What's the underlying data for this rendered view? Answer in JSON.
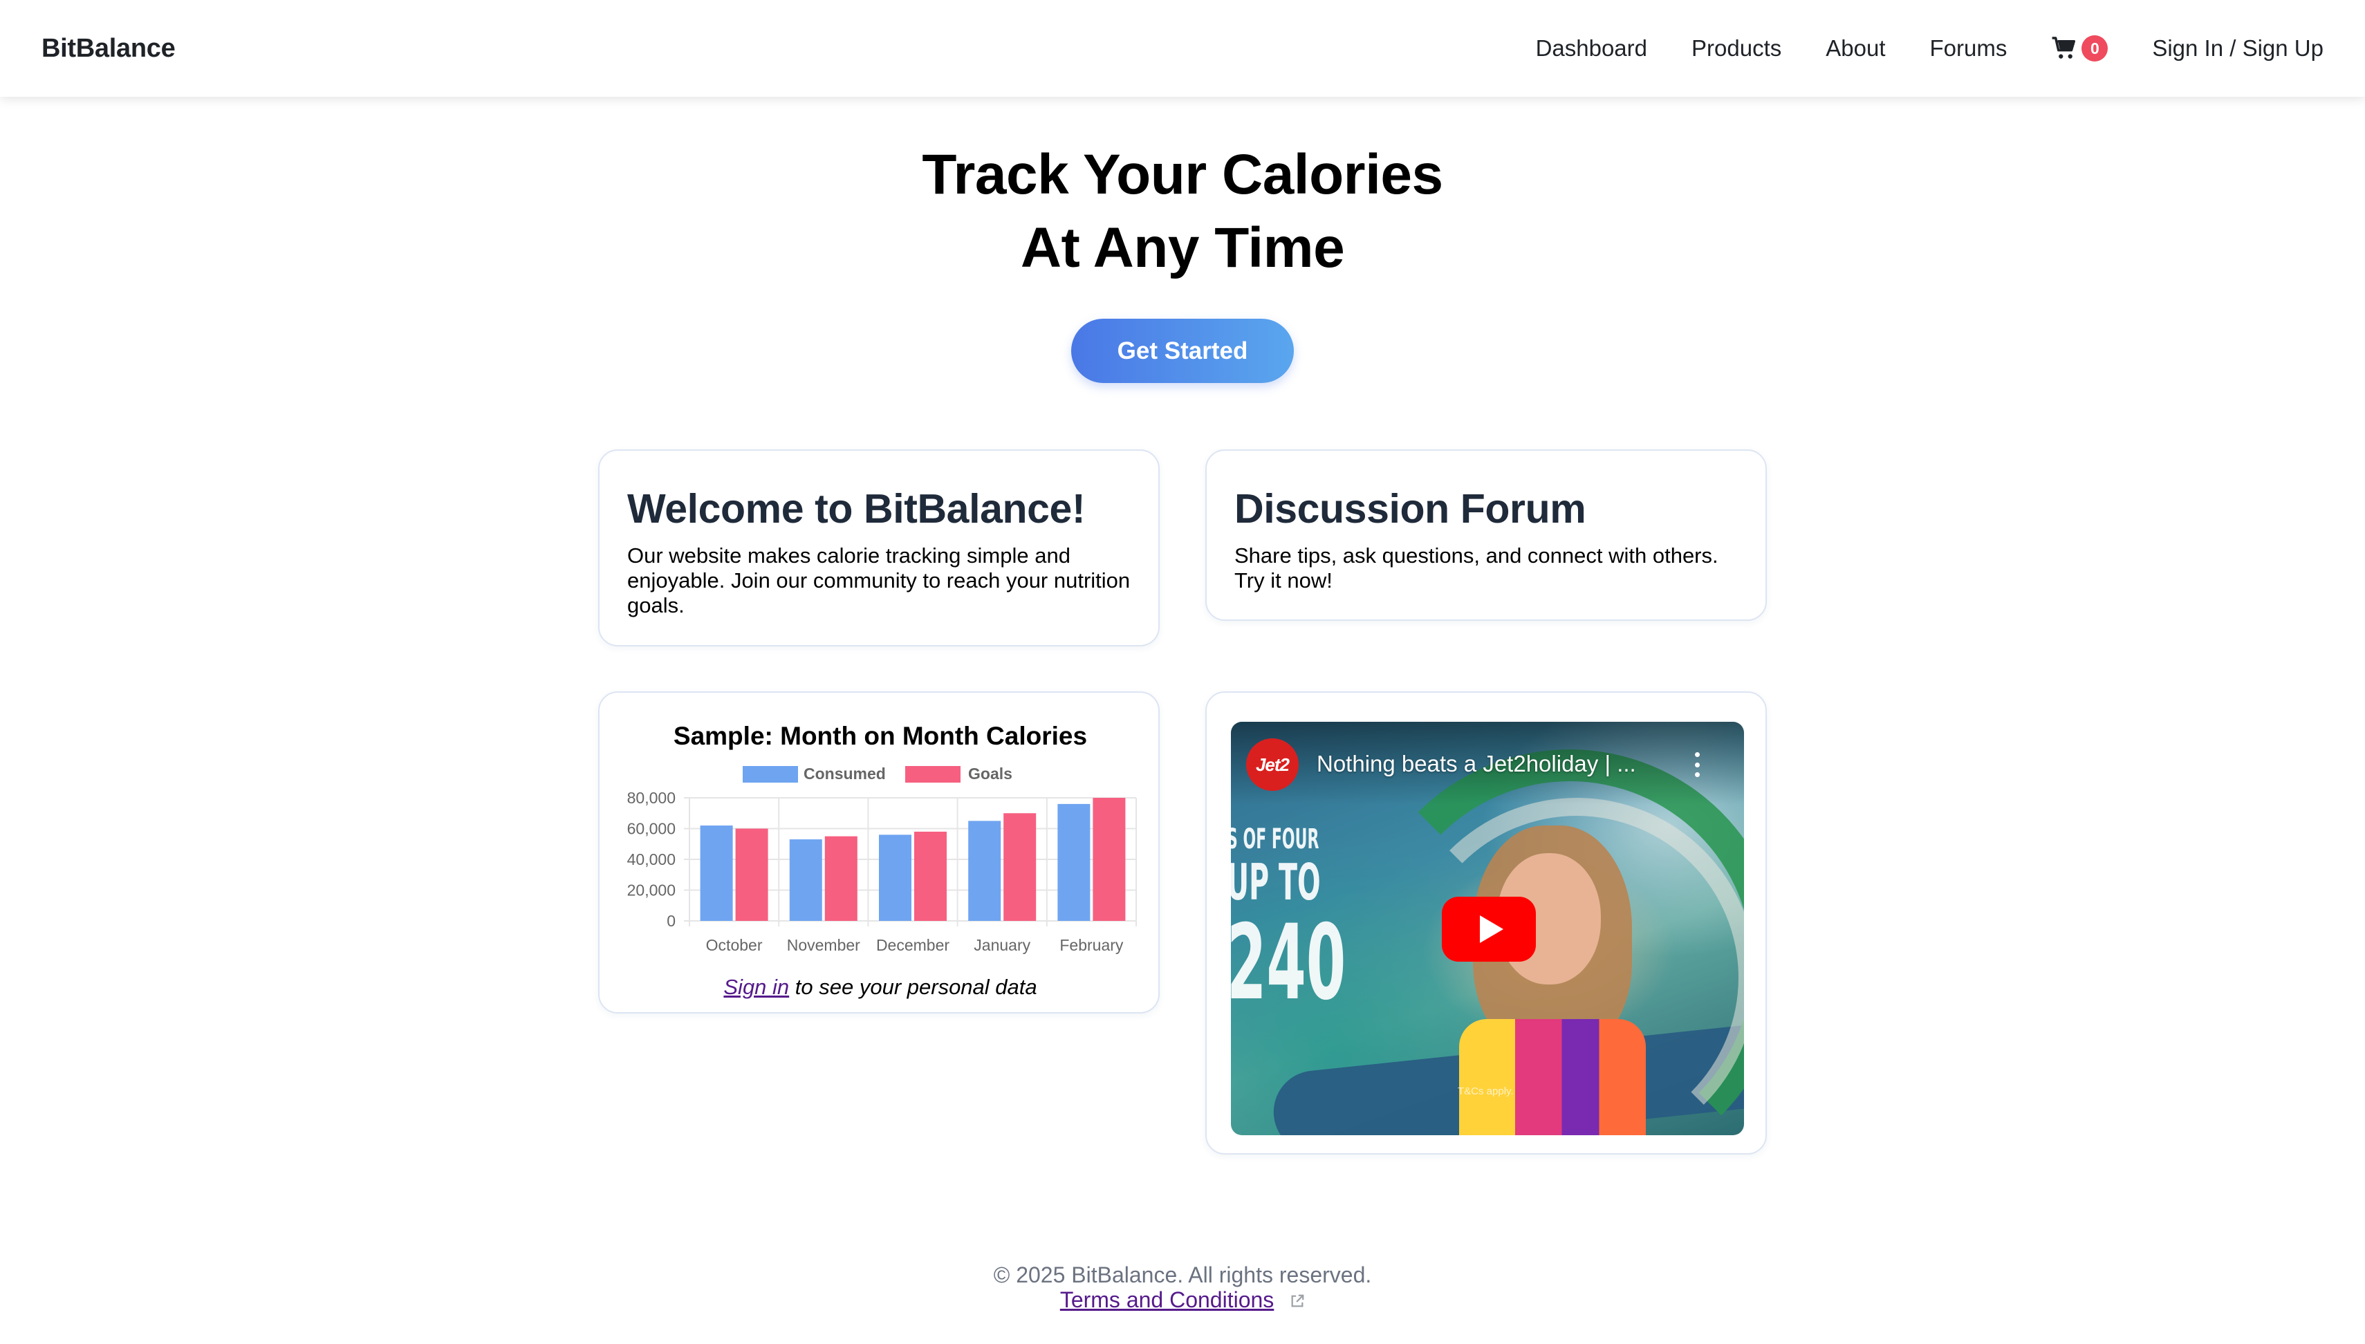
{
  "navbar": {
    "brand": "BitBalance",
    "links": [
      "Dashboard",
      "Products",
      "About",
      "Forums"
    ],
    "cart_count": "0",
    "signin_label": "Sign In / Sign Up"
  },
  "hero": {
    "title_line1": "Track Your Calories",
    "title_line2": "At Any Time",
    "cta_label": "Get Started"
  },
  "welcome_card": {
    "title": "Welcome to BitBalance!",
    "body": "Our website makes calorie tracking simple and enjoyable. Join our community to reach your nutrition goals."
  },
  "forum_card": {
    "title": "Discussion Forum",
    "body": "Share tips, ask questions, and connect with others. Try it now!"
  },
  "chart_card": {
    "footer_link": "Sign in",
    "footer_text": " to see your personal data"
  },
  "chart_data": {
    "type": "bar",
    "title": "Sample: Month on Month Calories",
    "categories": [
      "October",
      "November",
      "December",
      "January",
      "February"
    ],
    "series": [
      {
        "name": "Consumed",
        "color": "#6fa4f1",
        "values": [
          62000,
          53000,
          56000,
          65000,
          76000
        ]
      },
      {
        "name": "Goals",
        "color": "#f65f80",
        "values": [
          60000,
          55000,
          58000,
          70000,
          80000
        ]
      }
    ],
    "yticks": [
      "80,000",
      "60,000",
      "40,000",
      "20,000",
      "0"
    ],
    "ylim": [
      0,
      80000
    ],
    "grid": true,
    "legend": "top-center"
  },
  "video": {
    "channel_logo_text": "Jet2",
    "title": "Nothing beats a Jet2holiday | ...",
    "overlay_lines": [
      "S OF FOUR",
      "UP TO",
      "240"
    ],
    "fine_print": "T&Cs apply."
  },
  "footer": {
    "copyright": "© 2025 BitBalance. All rights reserved.",
    "terms_label": "Terms and Conditions"
  },
  "colors": {
    "accent_gradient_start": "#4a78e6",
    "accent_gradient_end": "#5aa6ee",
    "badge": "#ef4a5d",
    "link_visited": "#551a8b"
  },
  "icons": {
    "cart": "shopping-cart-icon",
    "external": "external-link-icon",
    "play": "play-icon",
    "menu": "more-vert-icon"
  }
}
